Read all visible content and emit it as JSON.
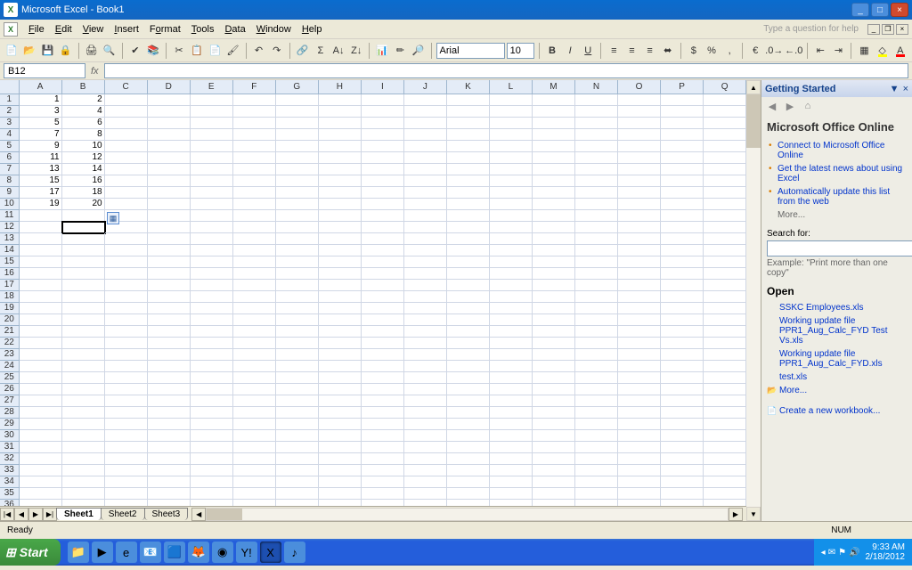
{
  "title": "Microsoft Excel - Book1",
  "menus": {
    "file": "File",
    "edit": "Edit",
    "view": "View",
    "insert": "Insert",
    "format": "Format",
    "tools": "Tools",
    "data": "Data",
    "window": "Window",
    "help": "Help"
  },
  "help_placeholder": "Type a question for help",
  "font": {
    "name": "Arial",
    "size": "10"
  },
  "name_box": "B12",
  "columns": [
    "A",
    "B",
    "C",
    "D",
    "E",
    "F",
    "G",
    "H",
    "I",
    "J",
    "K",
    "L",
    "M",
    "N",
    "O",
    "P",
    "Q"
  ],
  "rows": 36,
  "cells": {
    "A1": "1",
    "B1": "2",
    "A2": "3",
    "B2": "4",
    "A3": "5",
    "B3": "6",
    "A4": "7",
    "B4": "8",
    "A5": "9",
    "B5": "10",
    "A6": "11",
    "B6": "12",
    "A7": "13",
    "B7": "14",
    "A8": "15",
    "B8": "16",
    "A9": "17",
    "B9": "18",
    "A10": "19",
    "B10": "20"
  },
  "selected_cell": "B12",
  "sheets": [
    "Sheet1",
    "Sheet2",
    "Sheet3"
  ],
  "active_sheet": 0,
  "status": "Ready",
  "num_indicator": "NUM",
  "taskpane": {
    "header": "Getting Started",
    "title": "Microsoft Office Online",
    "links": [
      "Connect to Microsoft Office Online",
      "Get the latest news about using Excel",
      "Automatically update this list from the web"
    ],
    "more": "More...",
    "search_label": "Search for:",
    "example": "Example: \"Print more than one copy\"",
    "open_label": "Open",
    "files": [
      "SSKC Employees.xls",
      "Working update file PPR1_Aug_Calc_FYD Test Vs.xls",
      "Working update file PPR1_Aug_Calc_FYD.xls",
      "test.xls"
    ],
    "files_more": "More...",
    "create": "Create a new workbook..."
  },
  "taskbar": {
    "start": "Start",
    "time": "9:33 AM",
    "date": "2/18/2012"
  }
}
